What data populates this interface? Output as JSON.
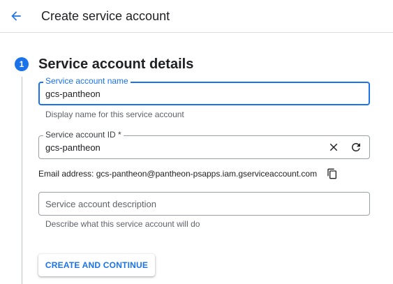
{
  "header": {
    "title": "Create service account"
  },
  "step": {
    "number": "1",
    "title": "Service account details"
  },
  "fields": {
    "name": {
      "label": "Service account name",
      "value": "gcs-pantheon",
      "hint": "Display name for this service account"
    },
    "id": {
      "label": "Service account ID *",
      "value": "gcs-pantheon"
    },
    "email": {
      "text": "Email address: gcs-pantheon@pantheon-psapps.iam.gserviceaccount.com"
    },
    "description": {
      "placeholder": "Service account description",
      "value": "",
      "hint": "Describe what this service account will do"
    }
  },
  "actions": {
    "create_label": "CREATE AND CONTINUE"
  },
  "colors": {
    "accent": "#1a73e8",
    "border": "#9aa0a6",
    "hint_text": "#5f6368"
  },
  "icons": {
    "back": "arrow-back-icon",
    "clear": "close-icon",
    "refresh": "refresh-icon",
    "copy": "copy-icon"
  }
}
